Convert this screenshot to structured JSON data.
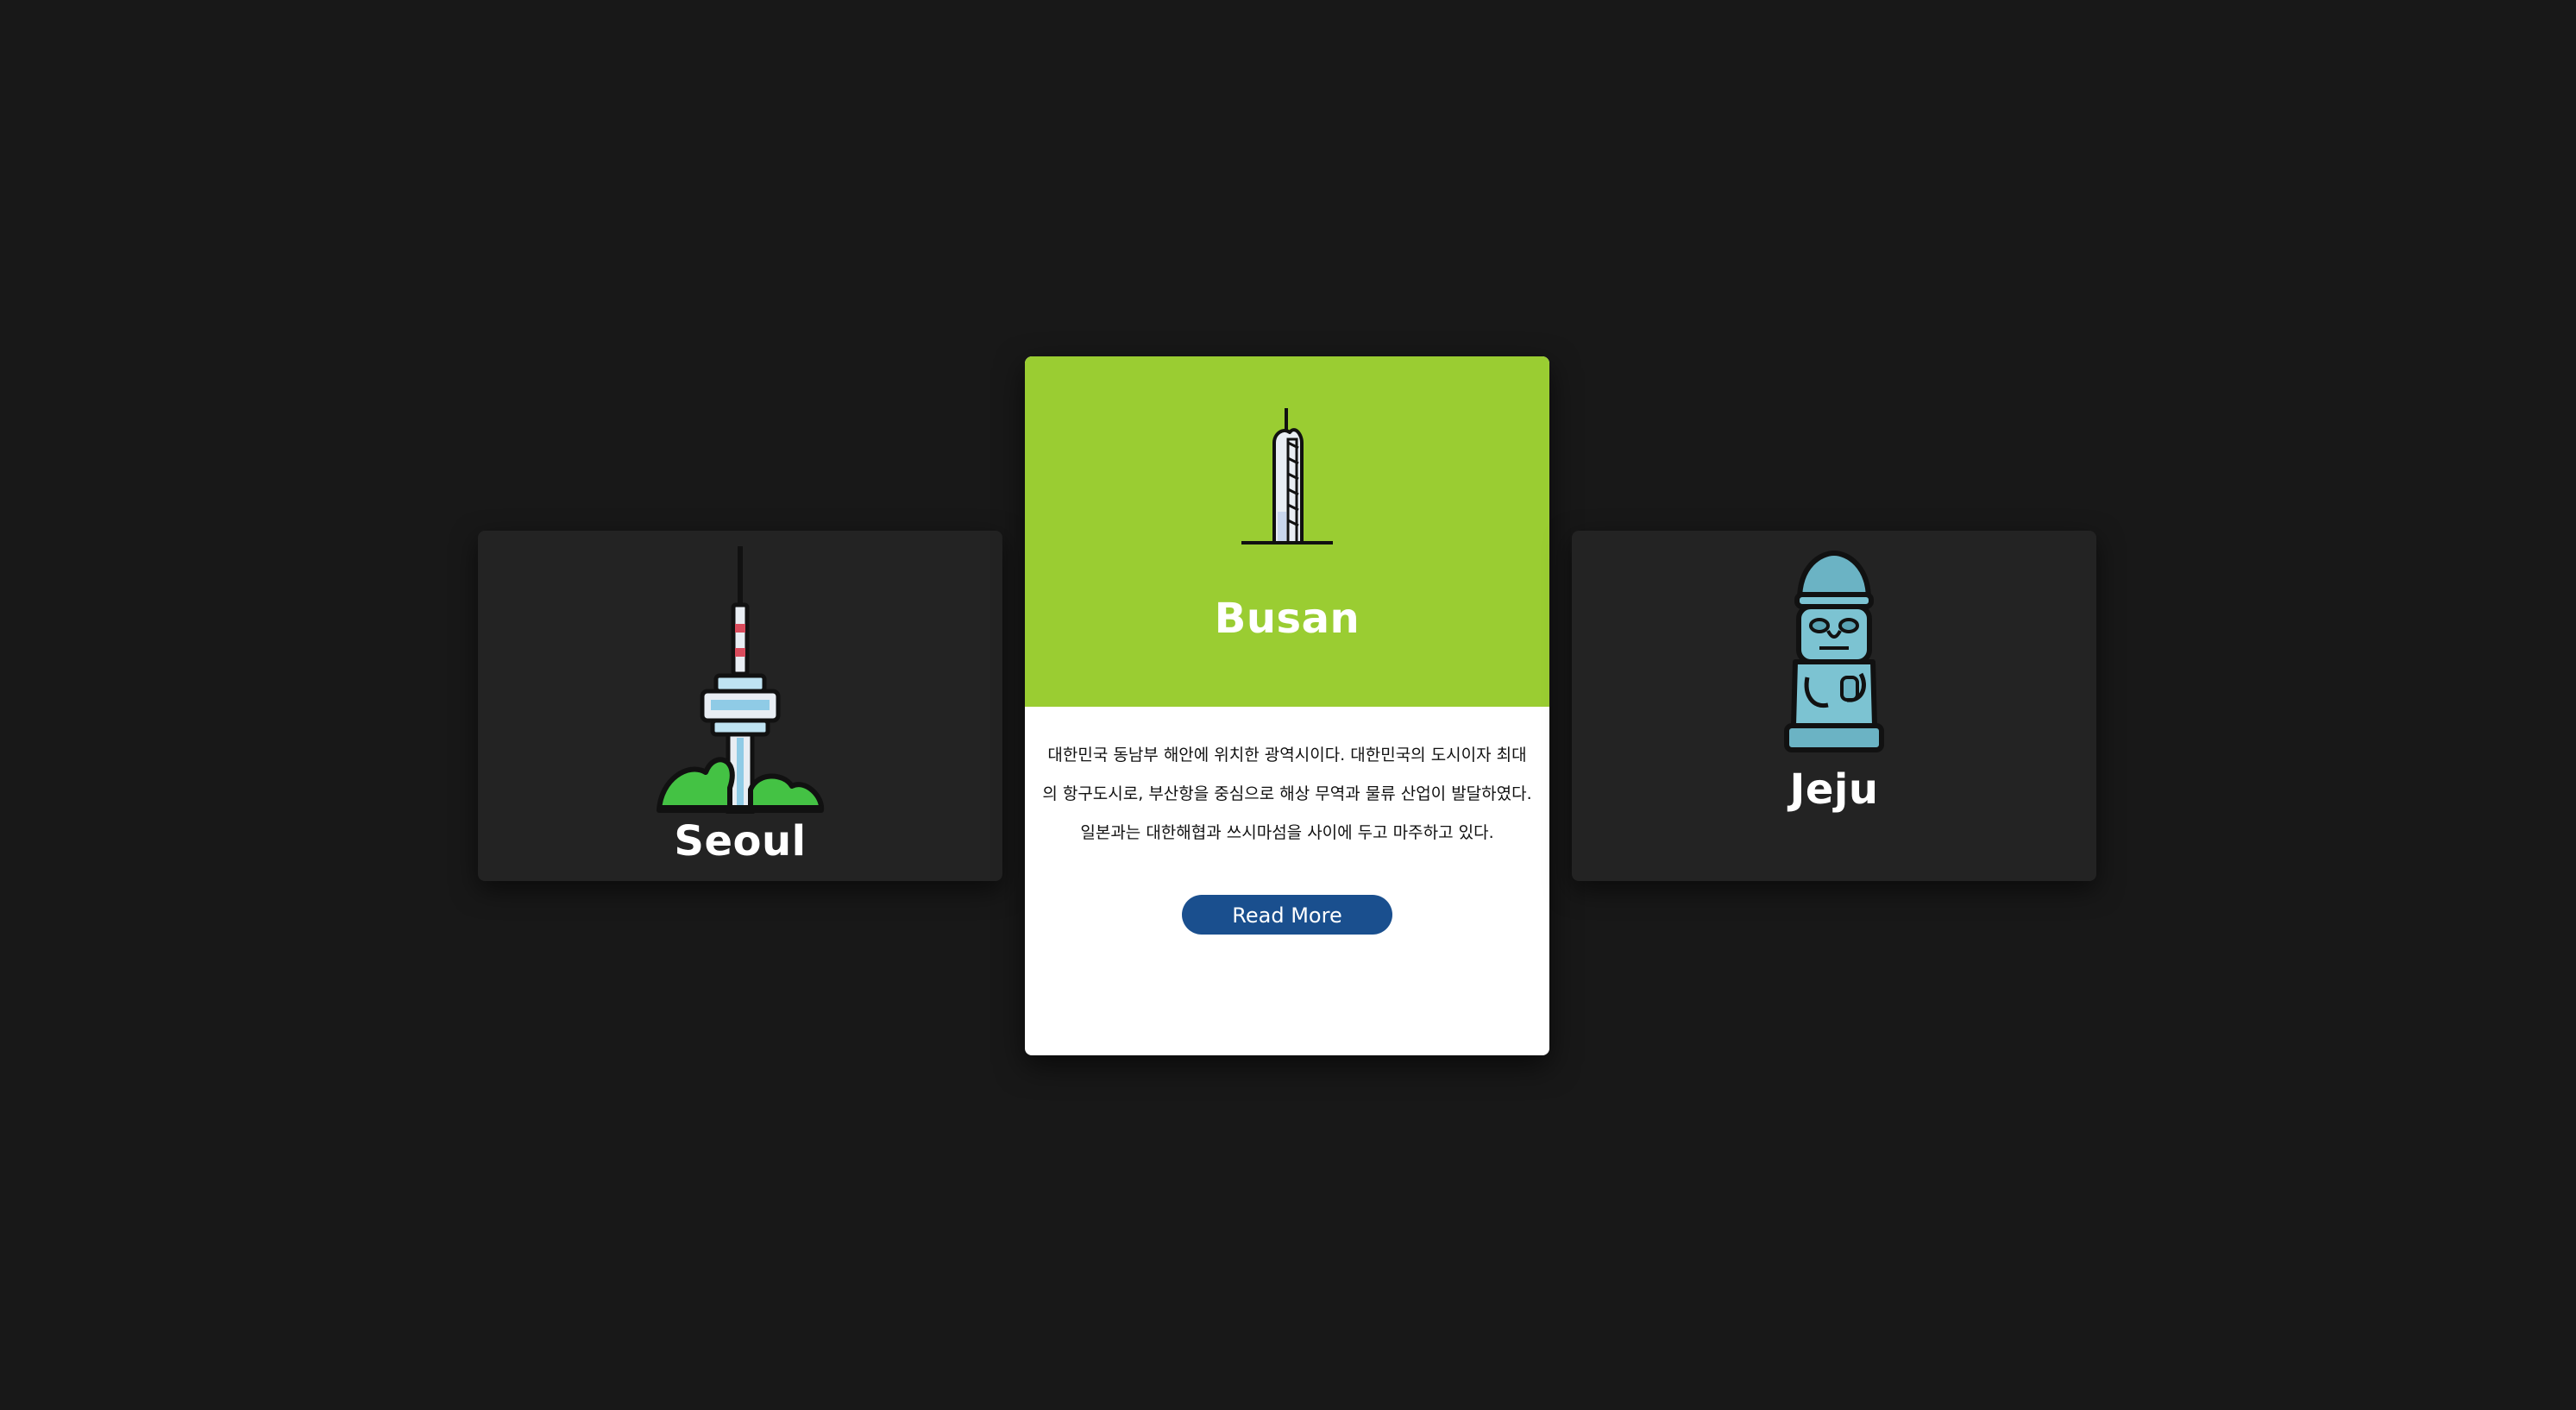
{
  "cards": [
    {
      "id": "seoul",
      "title": "Seoul",
      "icon": "namsan-tower-icon",
      "active": false
    },
    {
      "id": "busan",
      "title": "Busan",
      "icon": "skyscraper-icon",
      "active": true,
      "description": "대한민국 동남부 해안에 위치한 광역시이다. 대한민국의 도시이자 최대의 항구도시로, 부산항을 중심으로 해상 무역과 물류 산업이 발달하였다. 일본과는 대한해협과 쓰시마섬을 사이에 두고 마주하고 있다.",
      "button_label": "Read More"
    },
    {
      "id": "jeju",
      "title": "Jeju",
      "icon": "dol-hareubang-icon",
      "active": false
    }
  ],
  "colors": {
    "page_background": "#181818",
    "side_card_background": "#232323",
    "active_header": "#9acd32",
    "button": "#1a4f8e"
  }
}
